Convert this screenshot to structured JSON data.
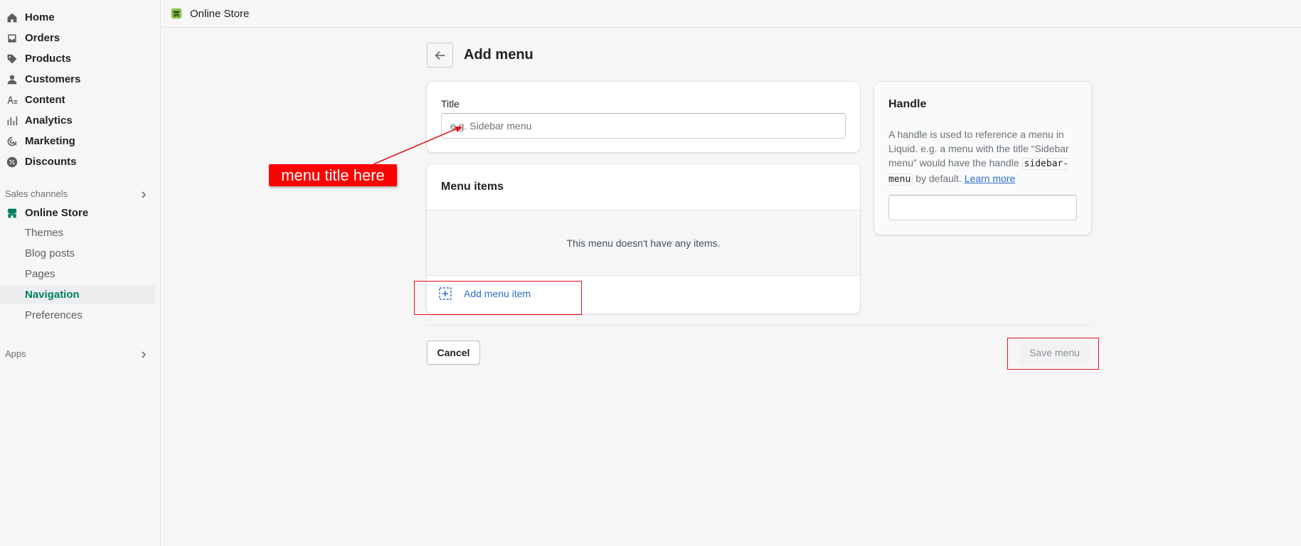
{
  "sidebar": {
    "items": [
      {
        "label": "Home",
        "icon": "home-icon"
      },
      {
        "label": "Orders",
        "icon": "orders-icon"
      },
      {
        "label": "Products",
        "icon": "tag-icon"
      },
      {
        "label": "Customers",
        "icon": "person-icon"
      },
      {
        "label": "Content",
        "icon": "content-icon"
      },
      {
        "label": "Analytics",
        "icon": "analytics-icon"
      },
      {
        "label": "Marketing",
        "icon": "marketing-icon"
      },
      {
        "label": "Discounts",
        "icon": "discount-icon"
      }
    ],
    "sales_channels_label": "Sales channels",
    "online_store_label": "Online Store",
    "sub_items": [
      {
        "label": "Themes"
      },
      {
        "label": "Blog posts"
      },
      {
        "label": "Pages"
      },
      {
        "label": "Navigation",
        "active": true
      },
      {
        "label": "Preferences"
      }
    ],
    "apps_label": "Apps"
  },
  "topbar": {
    "title": "Online Store"
  },
  "page": {
    "title": "Add menu"
  },
  "title_card": {
    "label": "Title",
    "placeholder": "e.g. Sidebar menu",
    "value": ""
  },
  "menu_items_card": {
    "title": "Menu items",
    "empty_text": "This menu doesn't have any items.",
    "add_label": "Add menu item"
  },
  "handle_card": {
    "title": "Handle",
    "desc_before": "A handle is used to reference a menu in Liquid. e.g. a menu with the title “Sidebar menu” would have the handle ",
    "code": "sidebar-menu",
    "desc_after": " by default. ",
    "learn_more": "Learn more",
    "value": ""
  },
  "footer": {
    "cancel_label": "Cancel",
    "save_label": "Save menu"
  },
  "annotation": {
    "label": "menu title here"
  },
  "colors": {
    "accent": "#008060",
    "link": "#2c6ecb",
    "annotation": "#ff0000"
  }
}
